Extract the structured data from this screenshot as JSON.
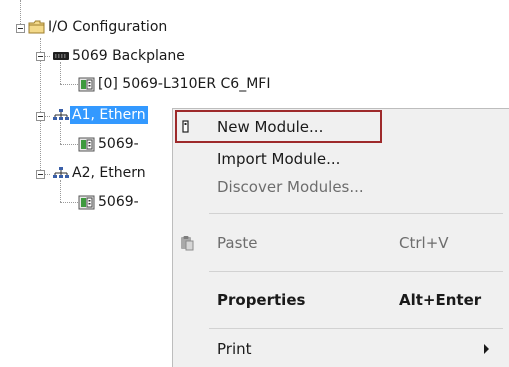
{
  "tree": {
    "io_configuration": "I/O Configuration",
    "backplane": "5069 Backplane",
    "controller": "[0] 5069-L310ER C6_MFI",
    "a1_ethernet": "A1, Ethern",
    "a1_child": "5069-",
    "a2_ethernet": "A2, Ethern",
    "a2_child": "5069-"
  },
  "menu": {
    "new_module": "New Module...",
    "import_module": "Import Module...",
    "discover_modules": "Discover Modules...",
    "paste": "Paste",
    "paste_shortcut": "Ctrl+V",
    "properties": "Properties",
    "properties_shortcut": "Alt+Enter",
    "print": "Print"
  },
  "colors": {
    "selection": "#3399ff",
    "menu_background": "#f0f0f0",
    "highlight_border": "#9e2a2b",
    "folder": "#e8c76a",
    "module_green": "#3e9a3e"
  }
}
